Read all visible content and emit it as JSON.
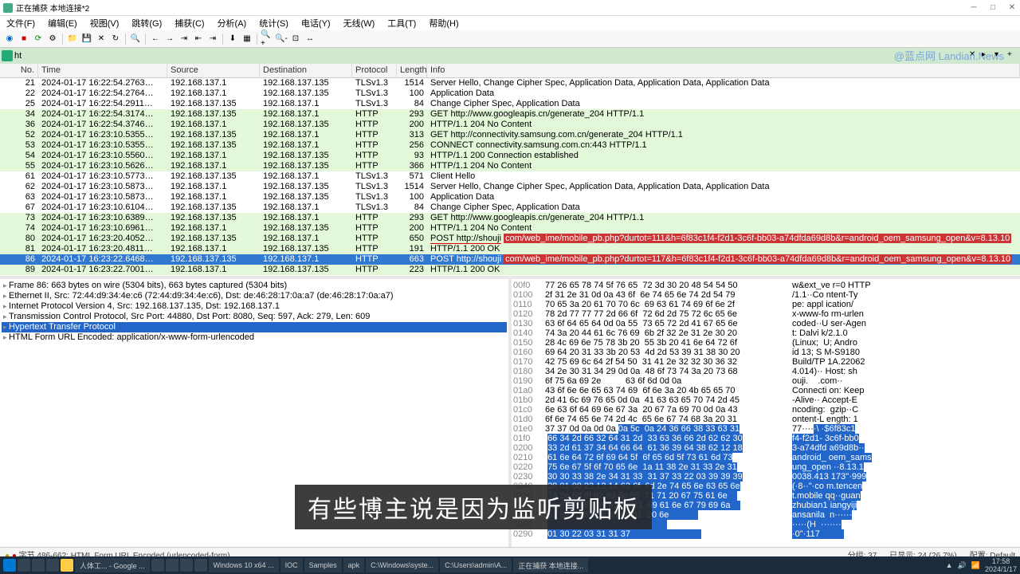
{
  "title": "正在捕获 本地连接*2",
  "menus": [
    "文件(F)",
    "编辑(E)",
    "视图(V)",
    "跳转(G)",
    "捕获(C)",
    "分析(A)",
    "统计(S)",
    "电话(Y)",
    "无线(W)",
    "工具(T)",
    "帮助(H)"
  ],
  "filter": "ht",
  "watermark": "@蓝点网 Landian.News",
  "headers": {
    "no": "No.",
    "time": "Time",
    "src": "Source",
    "dst": "Destination",
    "proto": "Protocol",
    "len": "Length",
    "info": "Info"
  },
  "packets": [
    {
      "no": "21",
      "time": "2024-01-17 16:22:54.2763…",
      "src": "192.168.137.1",
      "dst": "192.168.137.135",
      "proto": "TLSv1.3",
      "len": "1514",
      "info": "Server Hello, Change Cipher Spec, Application Data, Application Data, Application Data",
      "cls": "tls"
    },
    {
      "no": "22",
      "time": "2024-01-17 16:22:54.2764…",
      "src": "192.168.137.1",
      "dst": "192.168.137.135",
      "proto": "TLSv1.3",
      "len": "100",
      "info": "Application Data",
      "cls": "tls"
    },
    {
      "no": "25",
      "time": "2024-01-17 16:22:54.2911…",
      "src": "192.168.137.135",
      "dst": "192.168.137.1",
      "proto": "TLSv1.3",
      "len": "84",
      "info": "Change Cipher Spec, Application Data",
      "cls": "tls"
    },
    {
      "no": "34",
      "time": "2024-01-17 16:22:54.3174…",
      "src": "192.168.137.135",
      "dst": "192.168.137.1",
      "proto": "HTTP",
      "len": "293",
      "info": "GET http://www.googleapis.cn/generate_204 HTTP/1.1 ",
      "cls": "http"
    },
    {
      "no": "36",
      "time": "2024-01-17 16:22:54.3746…",
      "src": "192.168.137.1",
      "dst": "192.168.137.135",
      "proto": "HTTP",
      "len": "200",
      "info": "HTTP/1.1 204 No Content",
      "cls": "http"
    },
    {
      "no": "52",
      "time": "2024-01-17 16:23:10.5355…",
      "src": "192.168.137.135",
      "dst": "192.168.137.1",
      "proto": "HTTP",
      "len": "313",
      "info": "GET http://connectivity.samsung.com.cn/generate_204 HTTP/1.1 ",
      "cls": "http"
    },
    {
      "no": "53",
      "time": "2024-01-17 16:23:10.5355…",
      "src": "192.168.137.135",
      "dst": "192.168.137.1",
      "proto": "HTTP",
      "len": "256",
      "info": "CONNECT connectivity.samsung.com.cn:443 HTTP/1.1 ",
      "cls": "http"
    },
    {
      "no": "54",
      "time": "2024-01-17 16:23:10.5560…",
      "src": "192.168.137.1",
      "dst": "192.168.137.135",
      "proto": "HTTP",
      "len": "93",
      "info": "HTTP/1.1 200 Connection established",
      "cls": "http"
    },
    {
      "no": "55",
      "time": "2024-01-17 16:23:10.5626…",
      "src": "192.168.137.1",
      "dst": "192.168.137.135",
      "proto": "HTTP",
      "len": "366",
      "info": "HTTP/1.1 204 No Content",
      "cls": "http"
    },
    {
      "no": "61",
      "time": "2024-01-17 16:23:10.5773…",
      "src": "192.168.137.135",
      "dst": "192.168.137.1",
      "proto": "TLSv1.3",
      "len": "571",
      "info": "Client Hello",
      "cls": "tls"
    },
    {
      "no": "62",
      "time": "2024-01-17 16:23:10.5873…",
      "src": "192.168.137.1",
      "dst": "192.168.137.135",
      "proto": "TLSv1.3",
      "len": "1514",
      "info": "Server Hello, Change Cipher Spec, Application Data, Application Data, Application Data",
      "cls": "tls"
    },
    {
      "no": "63",
      "time": "2024-01-17 16:23:10.5873…",
      "src": "192.168.137.1",
      "dst": "192.168.137.135",
      "proto": "TLSv1.3",
      "len": "100",
      "info": "Application Data",
      "cls": "tls"
    },
    {
      "no": "67",
      "time": "2024-01-17 16:23:10.6104…",
      "src": "192.168.137.135",
      "dst": "192.168.137.1",
      "proto": "TLSv1.3",
      "len": "84",
      "info": "Change Cipher Spec, Application Data",
      "cls": "tls"
    },
    {
      "no": "73",
      "time": "2024-01-17 16:23:10.6389…",
      "src": "192.168.137.135",
      "dst": "192.168.137.1",
      "proto": "HTTP",
      "len": "293",
      "info": "GET http://www.googleapis.cn/generate_204 HTTP/1.1 ",
      "cls": "http"
    },
    {
      "no": "74",
      "time": "2024-01-17 16:23:10.6961…",
      "src": "192.168.137.1",
      "dst": "192.168.137.135",
      "proto": "HTTP",
      "len": "200",
      "info": "HTTP/1.1 204 No Content",
      "cls": "http"
    },
    {
      "no": "80",
      "time": "2024-01-17 16:23:20.4052…",
      "src": "192.168.137.135",
      "dst": "192.168.137.1",
      "proto": "HTTP",
      "len": "650",
      "info": "POST http://shouji",
      "info2": "com/web_ime/mobile_pb.php?durtot=111&h=6f83c1f4-f2d1-3c6f-bb03-a74dfda69d8b&r=android_oem_samsung_open&v=8.13.10",
      "cls": "http",
      "post": true
    },
    {
      "no": "81",
      "time": "2024-01-17 16:23:20.4811…",
      "src": "192.168.137.1",
      "dst": "192.168.137.135",
      "proto": "HTTP",
      "len": "191",
      "info": "HTTP/1.1 200 OK ",
      "cls": "http"
    },
    {
      "no": "86",
      "time": "2024-01-17 16:23:22.6468…",
      "src": "192.168.137.135",
      "dst": "192.168.137.1",
      "proto": "HTTP",
      "len": "663",
      "info": "POST http://shouji",
      "info2": "com/web_ime/mobile_pb.php?durtot=117&h=6f83c1f4-f2d1-3c6f-bb03-a74dfda69d8b&r=android_oem_samsung_open&v=8.13.10",
      "cls": "http",
      "sel": true,
      "post": true
    },
    {
      "no": "89",
      "time": "2024-01-17 16:23:22.7001…",
      "src": "192.168.137.1",
      "dst": "192.168.137.135",
      "proto": "HTTP",
      "len": "223",
      "info": "HTTP/1.1 200 OK ",
      "cls": "http"
    }
  ],
  "tree": [
    {
      "t": "Frame 86: 663 bytes on wire (5304 bits), 663 bytes captured (5304 bits)"
    },
    {
      "t": "Ethernet II, Src: 72:44:d9:34:4e:c6 (72:44:d9:34:4e:c6), Dst: de:46:28:17:0a:a7 (de:46:28:17:0a:a7)"
    },
    {
      "t": "Internet Protocol Version 4, Src: 192.168.137.135, Dst: 192.168.137.1"
    },
    {
      "t": "Transmission Control Protocol, Src Port: 44880, Dst Port: 8080, Seq: 597, Ack: 279, Len: 609"
    },
    {
      "t": "Hypertext Transfer Protocol",
      "sel": true
    },
    {
      "t": "HTML Form URL Encoded: application/x-www-form-urlencoded"
    }
  ],
  "hex": [
    {
      "o": "00f0",
      "b": "77 26 65 78 74 5f 76 65  72 3d 30 20 48 54 54 50",
      "a": "w&ext_ve r=0 HTTP"
    },
    {
      "o": "0100",
      "b": "2f 31 2e 31 0d 0a 43 6f  6e 74 65 6e 74 2d 54 79",
      "a": "/1.1··Co ntent-Ty"
    },
    {
      "o": "0110",
      "b": "70 65 3a 20 61 70 70 6c  69 63 61 74 69 6f 6e 2f",
      "a": "pe: appl ication/"
    },
    {
      "o": "0120",
      "b": "78 2d 77 77 77 2d 66 6f  72 6d 2d 75 72 6c 65 6e",
      "a": "x-www-fo rm-urlen"
    },
    {
      "o": "0130",
      "b": "63 6f 64 65 64 0d 0a 55  73 65 72 2d 41 67 65 6e",
      "a": "coded··U ser-Agen"
    },
    {
      "o": "0140",
      "b": "74 3a 20 44 61 6c 76 69  6b 2f 32 2e 31 2e 30 20",
      "a": "t: Dalvi k/2.1.0 "
    },
    {
      "o": "0150",
      "b": "28 4c 69 6e 75 78 3b 20  55 3b 20 41 6e 64 72 6f",
      "a": "(Linux;  U; Andro"
    },
    {
      "o": "0160",
      "b": "69 64 20 31 33 3b 20 53  4d 2d 53 39 31 38 30 20",
      "a": "id 13; S M-S9180 "
    },
    {
      "o": "0170",
      "b": "42 75 69 6c 64 2f 54 50  31 41 2e 32 32 30 36 32",
      "a": "Build/TP 1A.22062"
    },
    {
      "o": "0180",
      "b": "34 2e 30 31 34 29 0d 0a  48 6f 73 74 3a 20 73 68",
      "a": "4.014)·· Host: sh"
    },
    {
      "o": "0190",
      "b": "6f 75 6a 69 2e          63 6f 6d 0d 0a           ",
      "a": "ouji.    .com··  "
    },
    {
      "o": "01a0",
      "b": "43 6f 6e 6e 65 63 74 69  6f 6e 3a 20 4b 65 65 70",
      "a": "Connecti on: Keep"
    },
    {
      "o": "01b0",
      "b": "2d 41 6c 69 76 65 0d 0a  41 63 63 65 70 74 2d 45",
      "a": "-Alive·· Accept-E"
    },
    {
      "o": "01c0",
      "b": "6e 63 6f 64 69 6e 67 3a  20 67 7a 69 70 0d 0a 43",
      "a": "ncoding:  gzip··C"
    },
    {
      "o": "01d0",
      "b": "6f 6e 74 65 6e 74 2d 4c  65 6e 67 74 68 3a 20 31",
      "a": "ontent-L ength: 1"
    },
    {
      "o": "01e0",
      "b": "37 37 0d 0a 0d 0a",
      "bh": "0a 5c  0a 24 36 66 38 33 63 31",
      "a": "77····",
      "ah": "·\\ ·$6f83c1"
    },
    {
      "o": "01f0",
      "bh": "66 34 2d 66 32 64 31 2d  33 63 36 66 2d 62 62 30",
      "ah": "f4-f2d1- 3c6f-bb0"
    },
    {
      "o": "0200",
      "bh": "33 2d 61 37 34 64 66 64  61 36 39 64 38 62 12 18",
      "ah": "3-a74dfd a69d8b··"
    },
    {
      "o": "0210",
      "bh": "61 6e 64 72 6f 69 64 5f  6f 65 6d 5f 73 61 6d 73",
      "ah": "android_ oem_sams"
    },
    {
      "o": "0220",
      "bh": "75 6e 67 5f 6f 70 65 6e  1a 11 38 2e 31 33 2e 31",
      "ah": "ung_open ··8.13.1"
    },
    {
      "o": "0230",
      "bh": "30 30 33 38 2e 34 31 33  31 37 33 22 03 39 39 39",
      "ah": "0038.413 173\"·999"
    },
    {
      "o": "0240",
      "bh": "28 01 08 22 12 14 63 6f  6d 2e 74 65 6e 63 65 6e",
      "ah": "(·8··\"·co m.tencen"
    },
    {
      "o": "0250",
      "bh": "74 2e 6d 6f 62 69 6c 65  71 71 20 67 75 61 6e    ",
      "ah": "t.mobile qq··guan"
    },
    {
      "o": "0260",
      "bh": "7a 68 75 62 69 61 6e 31  69 61 6e 67 79 69 6a    ",
      "ah": "zhubian1 iangyiji"
    },
    {
      "o": "0270",
      "bh": "61 6e 73 61 6e 69 6c 61  20 6e            ",
      "ah": "ansanila  n······"
    },
    {
      "o": "0280",
      "bh": "                                                 ",
      "ah": "·····(H  ·······"
    },
    {
      "o": "0290",
      "bh": "01 30 22 03 31 31 37                             ",
      "ah": "·0\"·117          "
    }
  ],
  "status": {
    "left": "字节 486-662: HTML Form URL Encoded (urlencoded-form)",
    "mid": "分组: 37",
    "pkts": "已显示: 24 (26.7%)",
    "right": "配置: Default"
  },
  "subtitle": "有些博主说是因为监听剪贴板",
  "taskbar_items": [
    "Windows 10 x64 ...",
    "IOC",
    "Samples",
    "apk",
    "C:\\Windows\\syste...",
    "C:\\Users\\admin\\A...",
    "正在捕获 本地连接..."
  ],
  "taskbar_google": "人体工... - Google ...",
  "tray_time": "17:58",
  "tray_date": "2024/1/17"
}
